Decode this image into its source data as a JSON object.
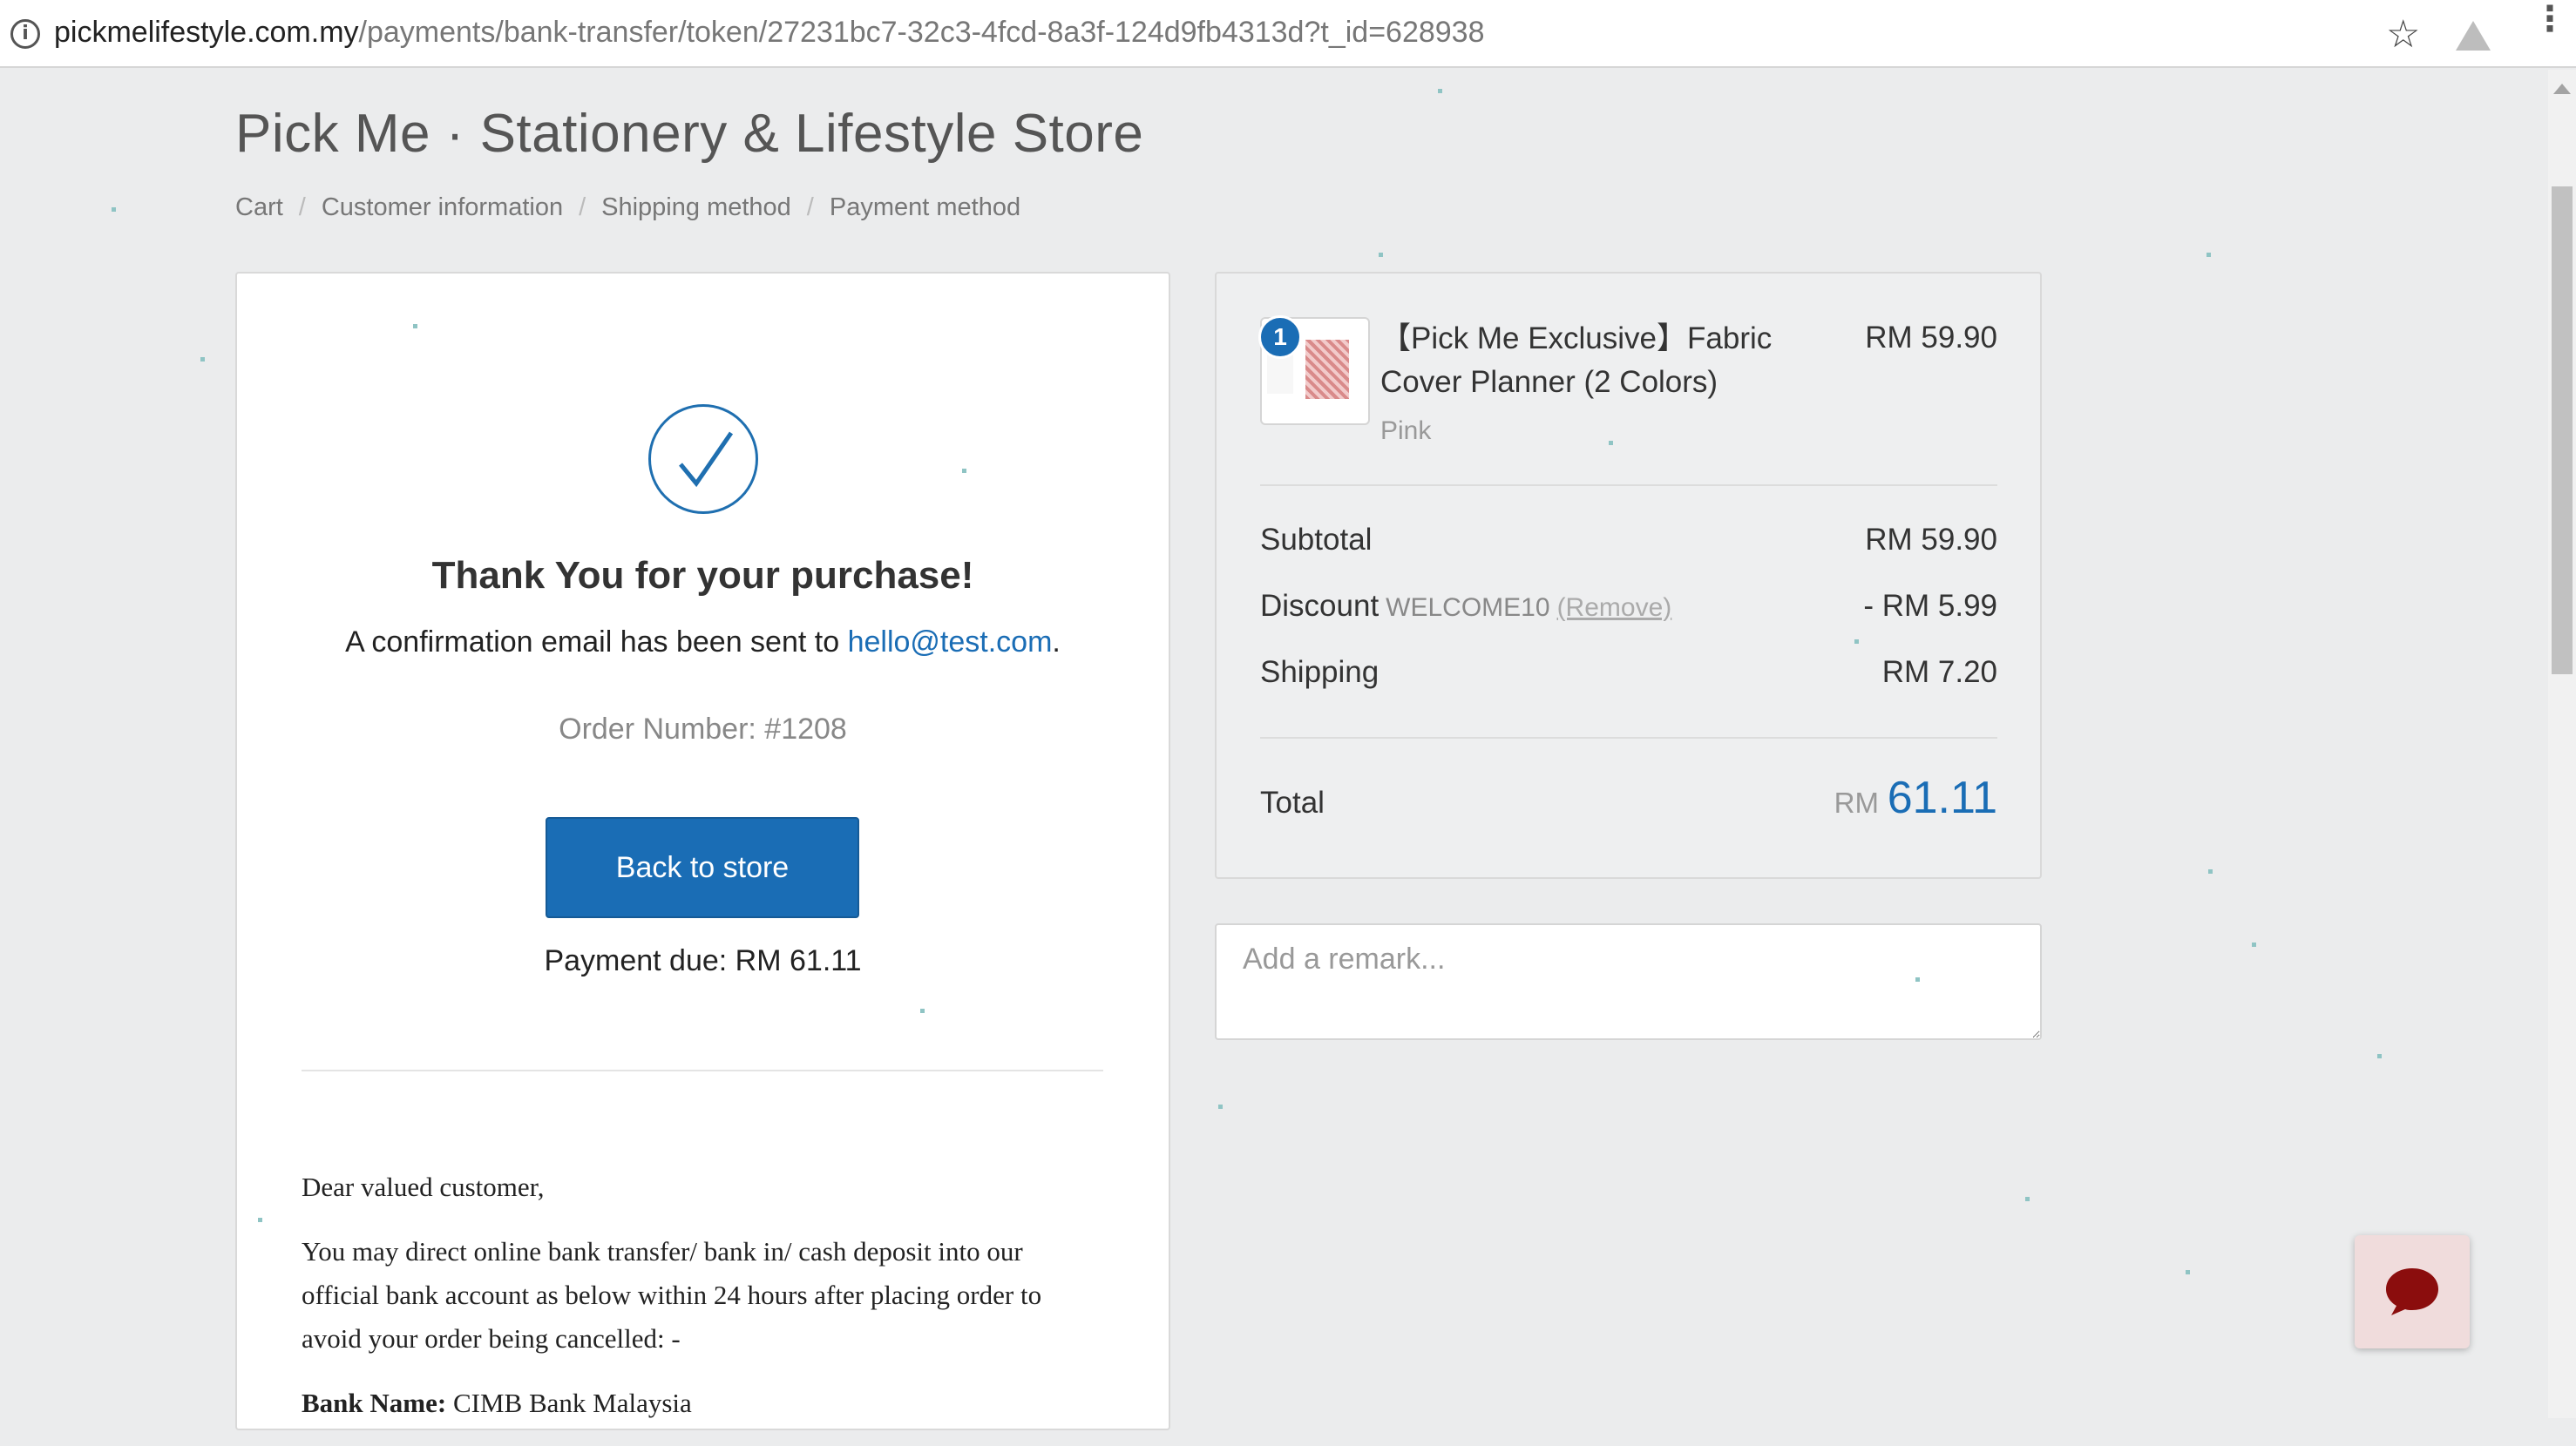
{
  "browser": {
    "url_domain": "pickmelifestyle.com.my",
    "url_path": "/payments/bank-transfer/token/27231bc7-32c3-4fcd-8a3f-124d9fb4313d?t_id=628938",
    "info_icon": "i",
    "star_icon": "☆",
    "menu_icon": "⋮"
  },
  "header": {
    "store_title": "Pick Me · Stationery & Lifestyle Store",
    "breadcrumb": [
      "Cart",
      "Customer information",
      "Shipping method",
      "Payment method"
    ],
    "breadcrumb_sep": "/"
  },
  "confirmation": {
    "heading": "Thank You for your purchase!",
    "email_prefix": "A confirmation email has been sent to ",
    "email": "hello@test.com",
    "email_suffix": ".",
    "order_number": "Order Number: #1208",
    "back_button": "Back to store",
    "payment_due": "Payment due: RM 61.11"
  },
  "letter": {
    "greeting": "Dear valued customer,",
    "body": "You may direct online bank transfer/ bank in/ cash deposit into our official bank account as below within 24 hours after placing order to avoid your order being cancelled: -",
    "bank_label": "Bank Name:",
    "bank_value": "CIMB Bank Malaysia"
  },
  "order_summary": {
    "item": {
      "quantity": "1",
      "name": "【Pick Me Exclusive】Fabric Cover Planner (2 Colors)",
      "variant": "Pink",
      "price": "RM 59.90"
    },
    "subtotal_label": "Subtotal",
    "subtotal_value": "RM 59.90",
    "discount_label": "Discount",
    "discount_code": "WELCOME10",
    "discount_remove": "(Remove)",
    "discount_value": "- RM 5.99",
    "shipping_label": "Shipping",
    "shipping_value": "RM 7.20",
    "total_label": "Total",
    "total_currency": "RM",
    "total_value": "61.11"
  },
  "remark": {
    "placeholder": "Add a remark..."
  },
  "colors": {
    "accent": "#1a6db5",
    "background": "#ebeced",
    "chat_icon": "#8b0d0d"
  }
}
